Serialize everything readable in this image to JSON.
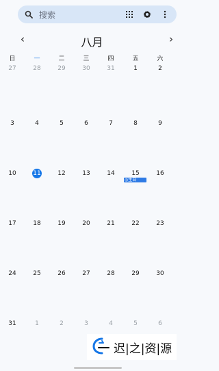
{
  "search": {
    "placeholder": "搜索",
    "icons": [
      "search-icon",
      "grid-icon",
      "settings-icon",
      "more-icon"
    ]
  },
  "month_nav": {
    "title": "八月",
    "prev": "‹",
    "next": "›"
  },
  "weekdays": [
    "日",
    "一",
    "二",
    "三",
    "四",
    "五",
    "六"
  ],
  "weeks": [
    [
      "27",
      "28",
      "29",
      "30",
      "31",
      "1",
      "2"
    ],
    [
      "3",
      "4",
      "5",
      "6",
      "7",
      "8",
      "9"
    ],
    [
      "10",
      "11",
      "12",
      "13",
      "14",
      "15",
      "16"
    ],
    [
      "17",
      "18",
      "19",
      "20",
      "21",
      "22",
      "23"
    ],
    [
      "24",
      "25",
      "26",
      "27",
      "28",
      "29",
      "30"
    ],
    [
      "31",
      "1",
      "2",
      "3",
      "4",
      "5",
      "6"
    ]
  ],
  "today": "11",
  "events": {
    "birthday": "◎生日"
  },
  "watermark": {
    "text": "迟|之|资|源"
  },
  "colors": {
    "accent": "#1677e7",
    "event": "#2f7be5",
    "search_bg": "#d8e6f7"
  }
}
